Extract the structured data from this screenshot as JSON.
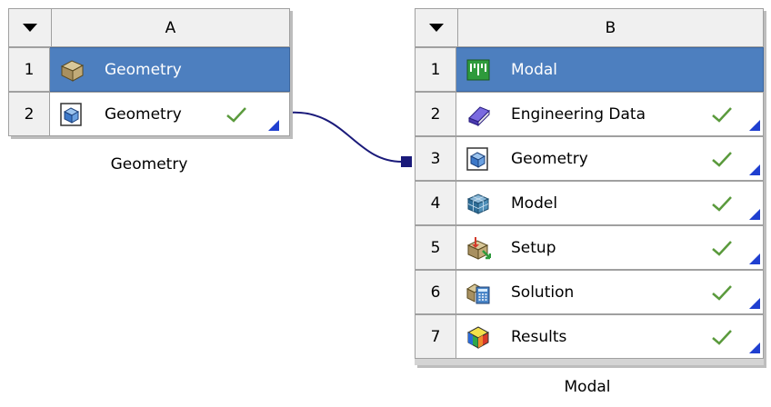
{
  "system_a": {
    "column_letter": "A",
    "caption": "Geometry",
    "rows": [
      {
        "num": "1",
        "label": "Geometry",
        "icon": "geometry-system-icon",
        "selected": true
      },
      {
        "num": "2",
        "label": "Geometry",
        "icon": "geometry-cell-icon",
        "status": "check-icon"
      }
    ]
  },
  "system_b": {
    "column_letter": "B",
    "caption": "Modal",
    "rows": [
      {
        "num": "1",
        "label": "Modal",
        "icon": "modal-icon",
        "selected": true
      },
      {
        "num": "2",
        "label": "Engineering Data",
        "icon": "engineering-data-icon",
        "status": "check-icon"
      },
      {
        "num": "3",
        "label": "Geometry",
        "icon": "geometry-cell-icon",
        "status": "check-icon"
      },
      {
        "num": "4",
        "label": "Model",
        "icon": "model-icon",
        "status": "check-icon"
      },
      {
        "num": "5",
        "label": "Setup",
        "icon": "setup-icon",
        "status": "check-icon"
      },
      {
        "num": "6",
        "label": "Solution",
        "icon": "solution-icon",
        "status": "check-icon"
      },
      {
        "num": "7",
        "label": "Results",
        "icon": "results-icon",
        "status": "check-icon"
      }
    ]
  },
  "colors": {
    "selected_row": "#4d7fbf",
    "connector": "#1a1a7a",
    "check": "#5a9a3c",
    "corner_marker": "#1f3fd0"
  }
}
